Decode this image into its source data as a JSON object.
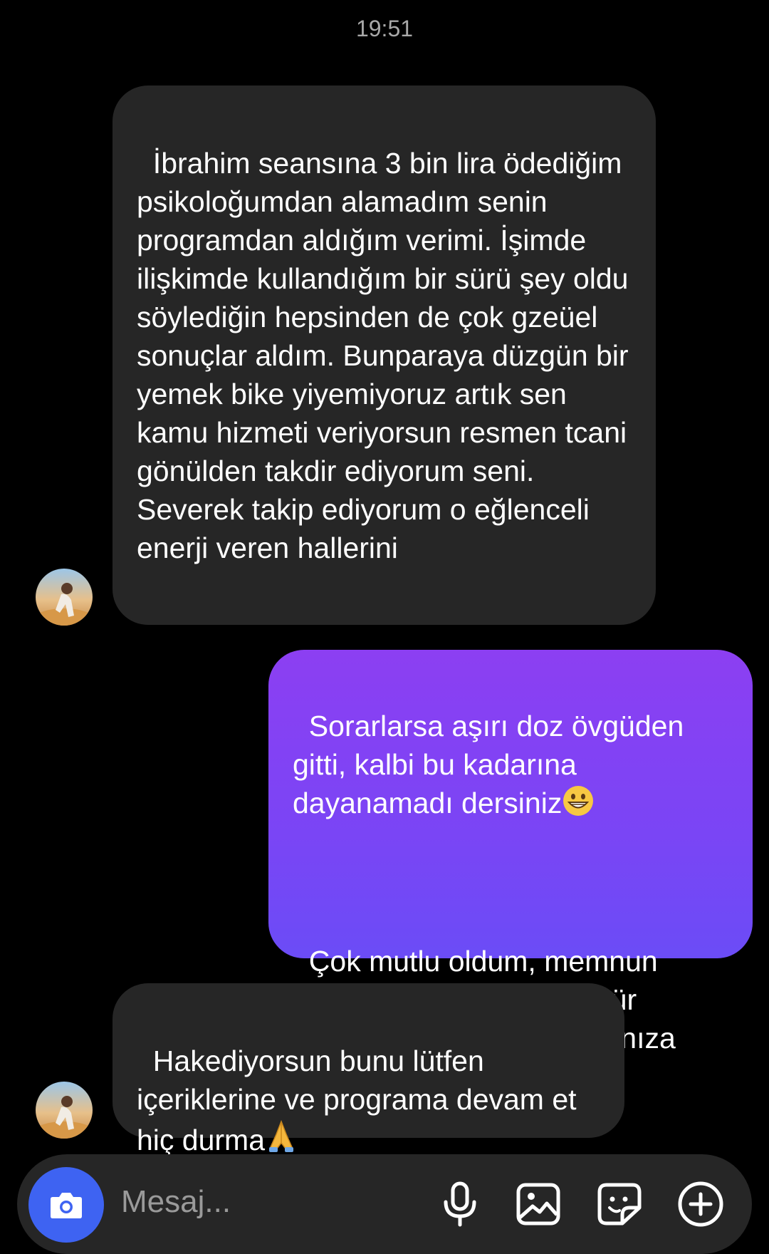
{
  "header": {
    "time": "19:51"
  },
  "messages": [
    {
      "direction": "incoming",
      "text": "İbrahim seansına 3 bin lira ödediğim psikoloğumdan alamadım senin programdan aldığım verimi. İşimde ilişkimde kullandığım bir sürü şey oldu söylediğin hepsinden de çok gzeüel sonuçlar aldım. Bunparaya düzgün bir yemek bike yiyemiyoruz artık sen kamu hizmeti veriyorsun resmen tcani gönülden takdir ediyorum seni. Severek takip ediyorum o eğlenceli enerji veren hallerini"
    },
    {
      "direction": "outgoing",
      "text_line1": "Sorarlarsa aşırı doz övgüden gitti, kalbi bu kadarına dayanamadı dersiniz",
      "emoji1": "grinning-face-emoji",
      "text_line2": "Çok mutlu oldum, memnun kalmanıza ve çok teşekkür ediyorum güzel yorumlarınıza"
    },
    {
      "direction": "incoming",
      "text": "Hakediyorsun bunu lütfen içeriklerine ve programa devam et hiç durma",
      "emoji": "folded-hands-emoji"
    }
  ],
  "composer": {
    "placeholder": "Mesaj...",
    "icons": [
      "camera-icon",
      "microphone-icon",
      "gallery-icon",
      "sticker-icon",
      "plus-circle-icon"
    ]
  },
  "colors": {
    "background": "#000000",
    "incoming_bubble": "#262626",
    "outgoing_bubble": "#7a45f5",
    "camera_button": "#3e63f2"
  }
}
